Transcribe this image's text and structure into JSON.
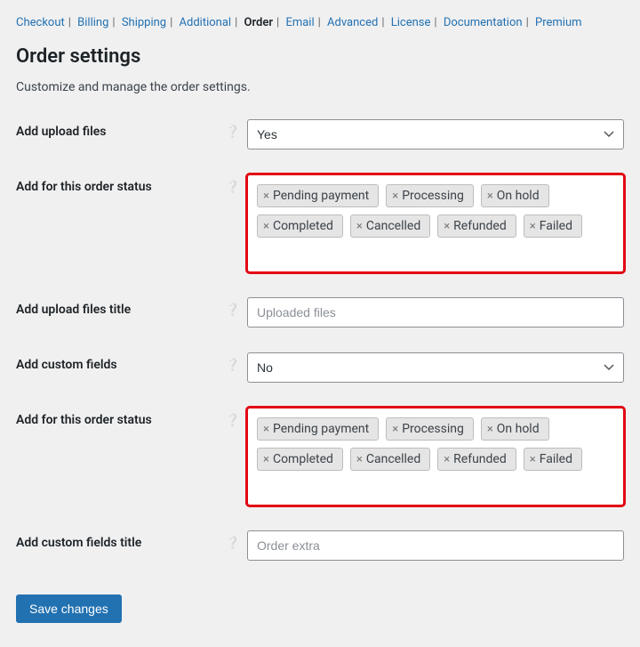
{
  "tabs": {
    "items": [
      {
        "label": "Checkout",
        "active": false
      },
      {
        "label": "Billing",
        "active": false
      },
      {
        "label": "Shipping",
        "active": false
      },
      {
        "label": "Additional",
        "active": false
      },
      {
        "label": "Order",
        "active": true
      },
      {
        "label": "Email",
        "active": false
      },
      {
        "label": "Advanced",
        "active": false
      },
      {
        "label": "License",
        "active": false
      },
      {
        "label": "Documentation",
        "active": false
      },
      {
        "label": "Premium",
        "active": false
      }
    ]
  },
  "page_title": "Order settings",
  "subtitle": "Customize and manage the order settings.",
  "fields": {
    "upload_files": {
      "label": "Add upload files",
      "value": "Yes"
    },
    "upload_status": {
      "label": "Add for this order status",
      "tags": [
        "Pending payment",
        "Processing",
        "On hold",
        "Completed",
        "Cancelled",
        "Refunded",
        "Failed"
      ]
    },
    "upload_title": {
      "label": "Add upload files title",
      "placeholder": "Uploaded files",
      "value": ""
    },
    "custom_fields": {
      "label": "Add custom fields",
      "value": "No"
    },
    "custom_status": {
      "label": "Add for this order status",
      "tags": [
        "Pending payment",
        "Processing",
        "On hold",
        "Completed",
        "Cancelled",
        "Refunded",
        "Failed"
      ]
    },
    "custom_title": {
      "label": "Add custom fields title",
      "placeholder": "Order extra",
      "value": ""
    }
  },
  "save_label": "Save changes"
}
